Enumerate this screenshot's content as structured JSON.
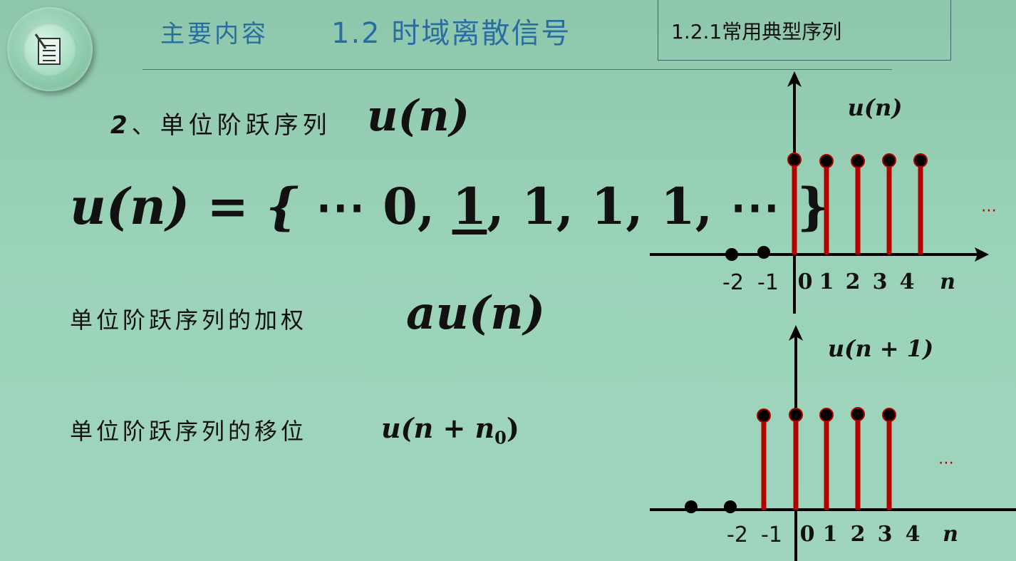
{
  "header": {
    "label": "主要内容",
    "title": "1.2 时域离散信号",
    "section": "1.2.1常用典型序列"
  },
  "heading": {
    "number": "2",
    "separator": "、",
    "text": "单位阶跃序列",
    "math": "u(n)"
  },
  "equation": {
    "lhs": "u(n) = {",
    "prefix": " ⋯ 0,",
    "underlined": "1",
    "rest": ", 1, 1, 1, ⋯ }"
  },
  "weighted": {
    "label": "单位阶跃序列的加权",
    "math": "au(n)"
  },
  "shifted": {
    "label": "单位阶跃序列的移位",
    "math_main": "u(n + n",
    "math_sub": "0",
    "math_close": ")"
  },
  "plot1": {
    "title": "u(n)",
    "ticks": [
      "-2",
      "-1",
      "0",
      "1",
      "2",
      "3",
      "4"
    ],
    "axis_label": "n",
    "ellipsis": "⋯"
  },
  "plot2": {
    "title": "u(n + 1)",
    "ticks": [
      "-2",
      "-1",
      "0",
      "1",
      "2",
      "3",
      "4"
    ],
    "axis_label": "n",
    "ellipsis": "⋯"
  },
  "colors": {
    "stem": "#b30000",
    "header_text": "#2a6ea0"
  }
}
